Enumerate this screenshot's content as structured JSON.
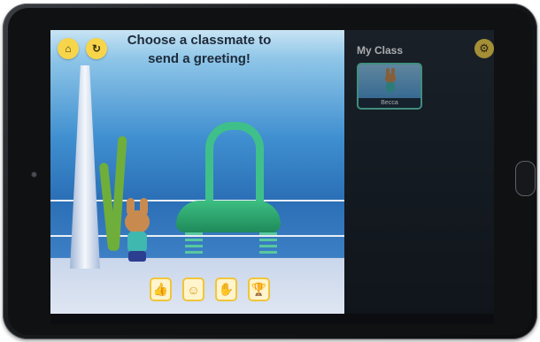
{
  "game": {
    "prompt": "Choose a classmate to send a greeting!",
    "home_icon": "home-icon",
    "refresh_icon": "refresh-icon"
  },
  "reactions": [
    {
      "name": "thumbs-up-icon",
      "glyph": "👍"
    },
    {
      "name": "smiley-icon",
      "glyph": "☺"
    },
    {
      "name": "clap-icon",
      "glyph": "✋"
    },
    {
      "name": "trophy-icon",
      "glyph": "🏆"
    }
  ],
  "class_panel": {
    "title": "My Class",
    "settings_icon": "gear-icon",
    "classmates": [
      {
        "name": "Becca"
      }
    ]
  },
  "colors": {
    "accent": "#f7d54a",
    "card_border": "#5fd2b8",
    "panel_bg": "#1a2027"
  }
}
